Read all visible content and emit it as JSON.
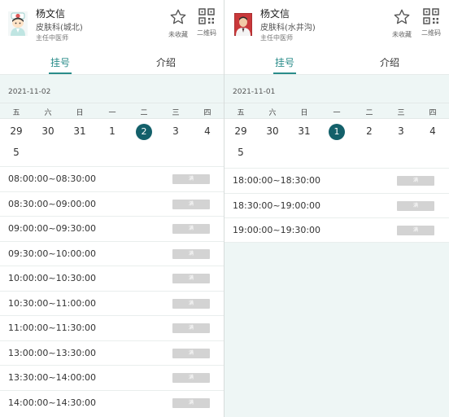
{
  "left": {
    "doctor": {
      "name": "杨文信",
      "department": "皮肤科(城北)",
      "title": "主任中医师"
    },
    "favorite_label": "未收藏",
    "qrcode_label": "二维码",
    "tabs": {
      "register": "挂号",
      "intro": "介绍"
    },
    "date": "2021-11-02",
    "weekdays": [
      "五",
      "六",
      "日",
      "一",
      "二",
      "三",
      "四"
    ],
    "days": [
      "29",
      "30",
      "31",
      "1",
      "2",
      "3",
      "4",
      "5"
    ],
    "selected_day": "2",
    "slots": [
      {
        "time": "08:00:00~08:30:00",
        "status": "满"
      },
      {
        "time": "08:30:00~09:00:00",
        "status": "满"
      },
      {
        "time": "09:00:00~09:30:00",
        "status": "满"
      },
      {
        "time": "09:30:00~10:00:00",
        "status": "满"
      },
      {
        "time": "10:00:00~10:30:00",
        "status": "满"
      },
      {
        "time": "10:30:00~11:00:00",
        "status": "满"
      },
      {
        "time": "11:00:00~11:30:00",
        "status": "满"
      },
      {
        "time": "13:00:00~13:30:00",
        "status": "满"
      },
      {
        "time": "13:30:00~14:00:00",
        "status": "满"
      },
      {
        "time": "14:00:00~14:30:00",
        "status": "满"
      }
    ]
  },
  "right": {
    "doctor": {
      "name": "杨文信",
      "department": "皮肤科(水井沟)",
      "title": "主任中医师"
    },
    "favorite_label": "未收藏",
    "qrcode_label": "二维码",
    "tabs": {
      "register": "挂号",
      "intro": "介绍"
    },
    "date": "2021-11-01",
    "weekdays": [
      "五",
      "六",
      "日",
      "一",
      "二",
      "三",
      "四"
    ],
    "days": [
      "29",
      "30",
      "31",
      "1",
      "2",
      "3",
      "4",
      "5"
    ],
    "selected_day": "1",
    "slots": [
      {
        "time": "18:00:00~18:30:00",
        "status": "满"
      },
      {
        "time": "18:30:00~19:00:00",
        "status": "满"
      },
      {
        "time": "19:00:00~19:30:00",
        "status": "满"
      }
    ]
  },
  "colors": {
    "accent": "#2a8c8a",
    "selected_day": "#13606a",
    "full_button": "#d3d3d3",
    "background_tint": "#eef6f5"
  },
  "icons": {
    "favorite": "star-outline-icon",
    "qrcode": "qrcode-icon",
    "avatar_left": "nurse-avatar-icon",
    "avatar_right": "doctor-photo-icon"
  }
}
